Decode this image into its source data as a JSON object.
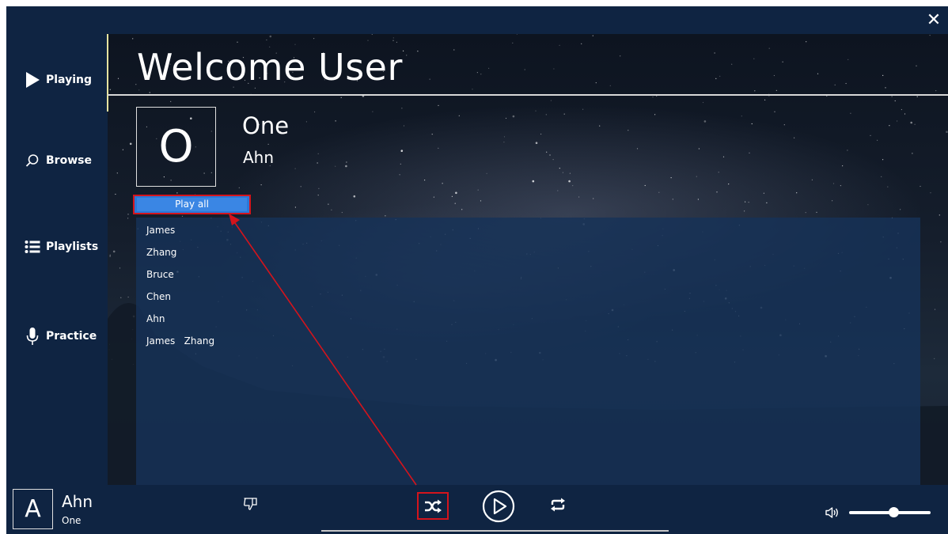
{
  "window": {
    "close_glyph": "✕"
  },
  "sidebar": {
    "items": [
      {
        "label": "Playing",
        "icon": "play-triangle-icon"
      },
      {
        "label": "Browse",
        "icon": "search-icon"
      },
      {
        "label": "Playlists",
        "icon": "list-icon"
      },
      {
        "label": "Practice",
        "icon": "microphone-icon"
      }
    ]
  },
  "header": {
    "title": "Welcome User"
  },
  "album": {
    "letter": "O",
    "title": "One",
    "artist": "Ahn"
  },
  "actions": {
    "play_all": "Play all"
  },
  "tracks": [
    "James",
    "Zhang",
    "Bruce",
    "Chen",
    "Ahn",
    "James   Zhang"
  ],
  "now_playing": {
    "letter": "A",
    "title": "Ahn",
    "subtitle": "One"
  },
  "player": {
    "icons": [
      "thumbs-down-icon",
      "shuffle-icon",
      "play-circle-icon",
      "repeat-icon",
      "volume-icon"
    ],
    "volume_level": 0.55
  },
  "colors": {
    "background": "#0f2442",
    "accent_blue": "#2b78d8",
    "highlight_red": "#d4141c",
    "active_bar": "#e6e3a0"
  }
}
